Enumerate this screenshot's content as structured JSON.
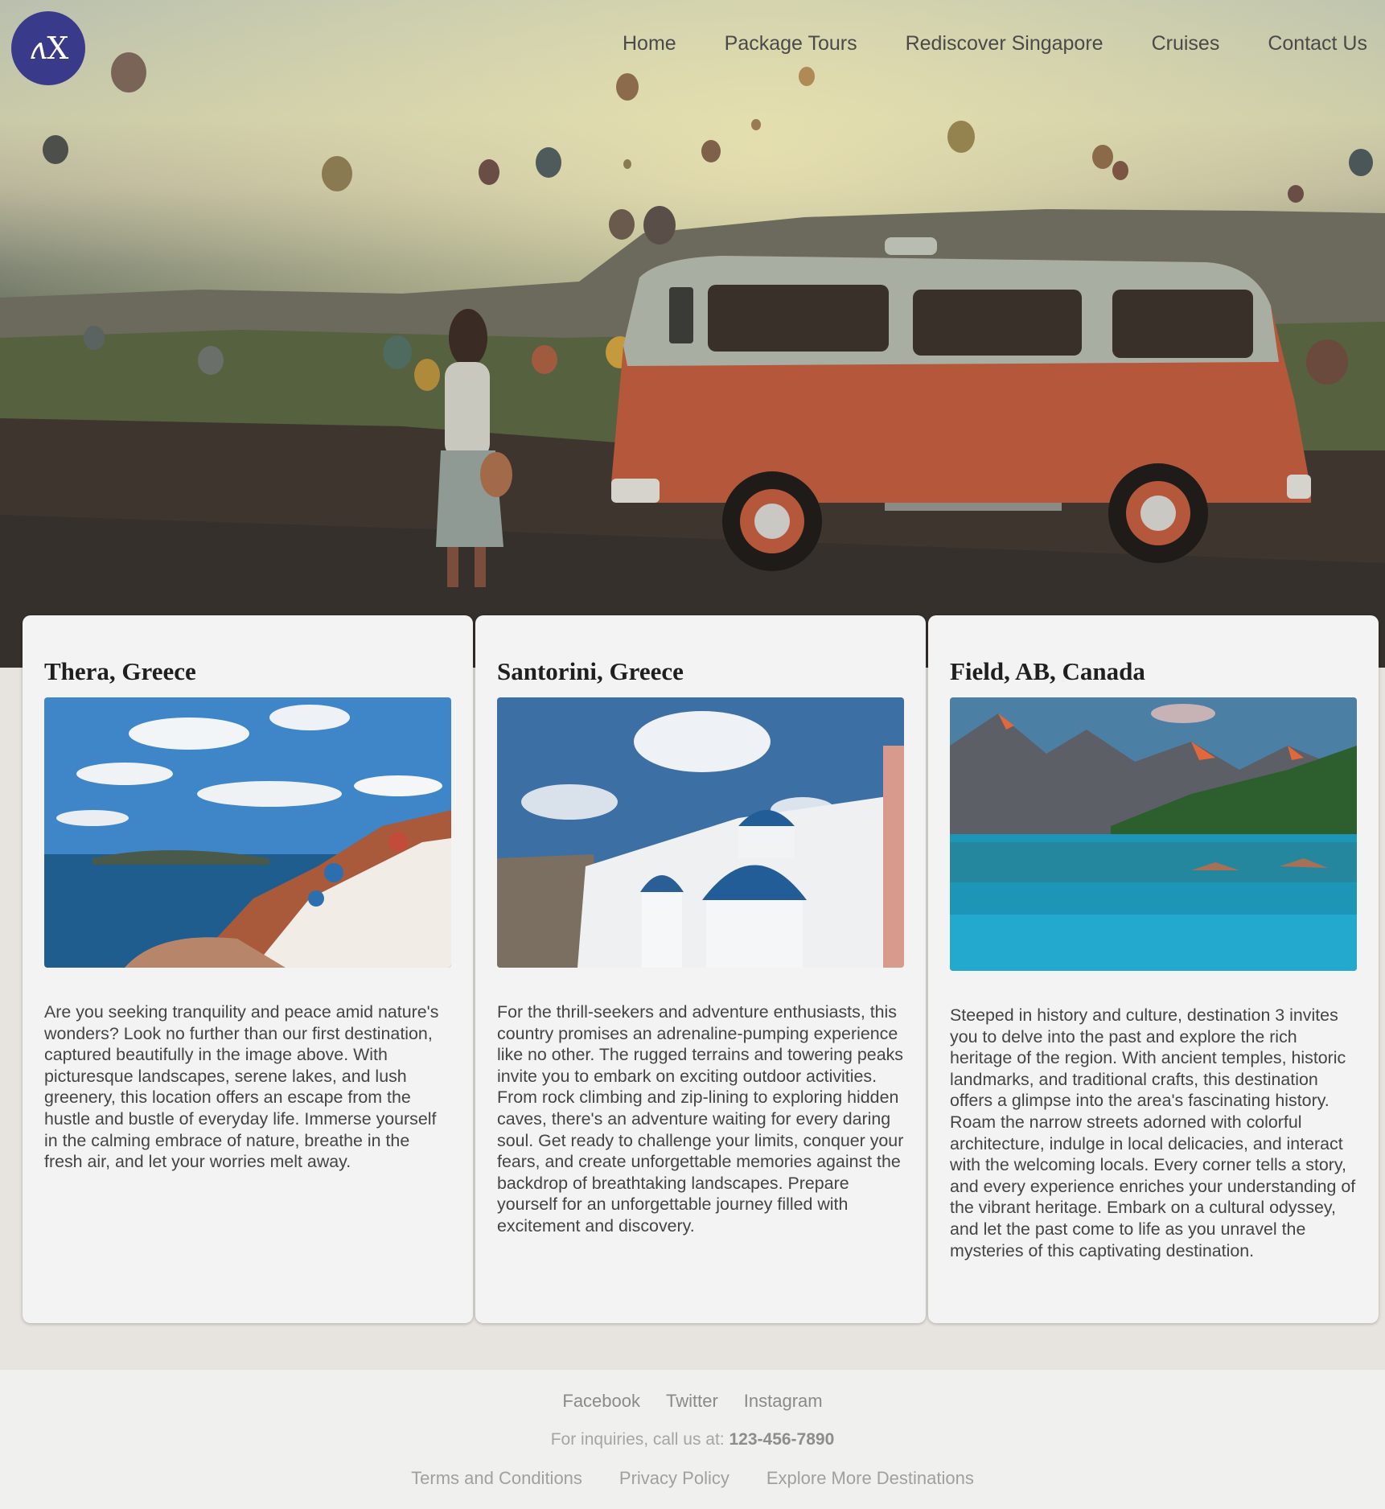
{
  "logo": {
    "text": "X",
    "mark": "ʌ"
  },
  "nav": {
    "items": [
      {
        "label": "Home"
      },
      {
        "label": "Package Tours"
      },
      {
        "label": "Rediscover Singapore"
      },
      {
        "label": "Cruises"
      },
      {
        "label": "Contact Us"
      }
    ]
  },
  "hero": {
    "image": "hot-air-balloons-and-vintage-van-landscape"
  },
  "cards": [
    {
      "title": "Thera, Greece",
      "image": "seaside-cliff-village-photo",
      "body": "Are you seeking tranquility and peace amid nature's wonders? Look no further than our first destination, captured beautifully in the image above. With picturesque landscapes, serene lakes, and lush greenery, this location offers an escape from the hustle and bustle of everyday life. Immerse yourself in the calming embrace of nature, breathe in the fresh air, and let your worries melt away."
    },
    {
      "title": "Santorini, Greece",
      "image": "blue-dome-churches-photo",
      "body": "For the thrill-seekers and adventure enthusiasts, this country promises an adrenaline-pumping experience like no other. The rugged terrains and towering peaks invite you to embark on exciting outdoor activities. From rock climbing and zip-lining to exploring hidden caves, there's an adventure waiting for every daring soul. Get ready to challenge your limits, conquer your fears, and create unforgettable memories against the backdrop of breathtaking landscapes. Prepare yourself for an unforgettable journey filled with excitement and discovery."
    },
    {
      "title": "Field, AB, Canada",
      "image": "mountain-lake-reflection-photo",
      "body": "Steeped in history and culture, destination 3 invites you to delve into the past and explore the rich heritage of the region. With ancient temples, historic landmarks, and traditional crafts, this destination offers a glimpse into the area's fascinating history. Roam the narrow streets adorned with colorful architecture, indulge in local delicacies, and interact with the welcoming locals. Every corner tells a story, and every experience enriches your understanding of the vibrant heritage. Embark on a cultural odyssey, and let the past come to life as you unravel the mysteries of this captivating destination."
    }
  ],
  "footer": {
    "social": [
      {
        "label": "Facebook"
      },
      {
        "label": "Twitter"
      },
      {
        "label": "Instagram"
      }
    ],
    "inquiry_prefix": "For inquiries, call us at:",
    "phone": "123-456-7890",
    "links": [
      {
        "label": "Terms and Conditions"
      },
      {
        "label": "Privacy Policy"
      },
      {
        "label": "Explore More Destinations"
      }
    ]
  },
  "colors": {
    "logo_bg": "#3a3a8a",
    "page_bg": "#e7e4df",
    "card_bg": "#f3f3f3",
    "footer_bg": "#f0f0ee",
    "van": "#b5573b"
  }
}
